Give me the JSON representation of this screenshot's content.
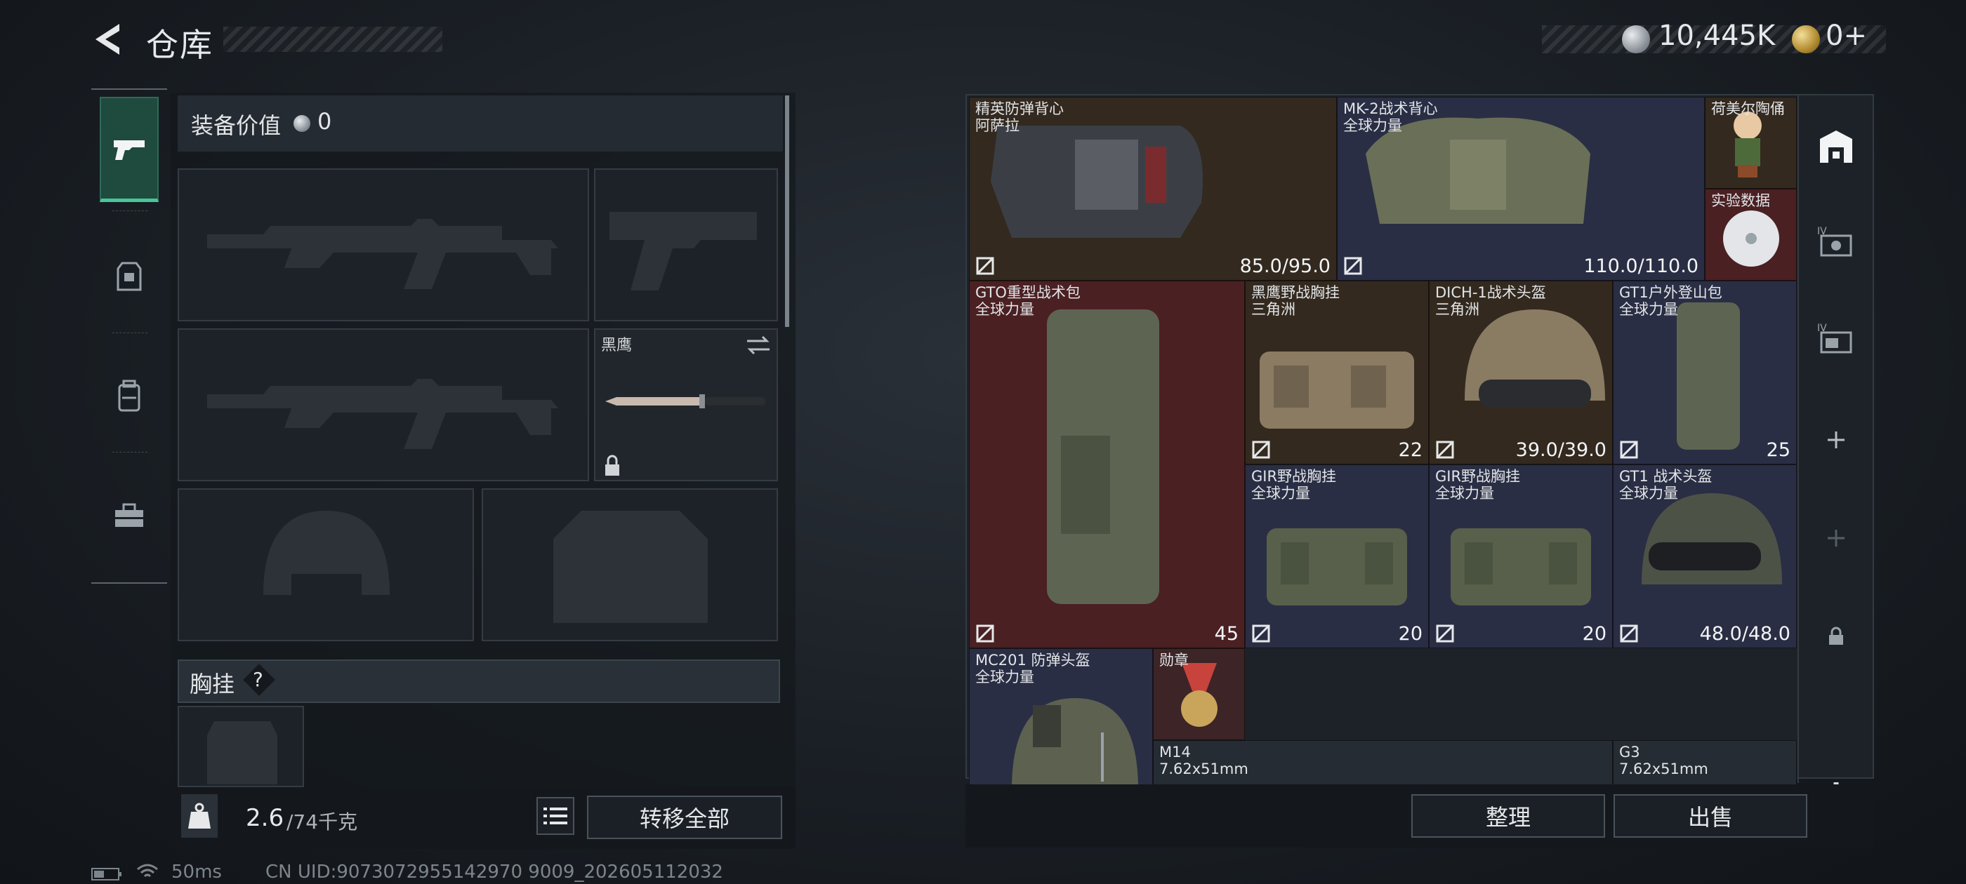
{
  "header": {
    "title": "仓库"
  },
  "currency": {
    "silver_value": "10,445K",
    "gold_value": "0+"
  },
  "equipment": {
    "value_label": "装备价值",
    "value_amount": "0",
    "knife_slot_label": "黑鹰",
    "section_title": "胸挂",
    "section_help": "?"
  },
  "weight": {
    "current": "2.6",
    "max_unit": "/74千克"
  },
  "buttons": {
    "transfer_all": "转移全部",
    "organize": "整理",
    "sell": "出售"
  },
  "status_bar": {
    "ping": "50ms",
    "uid": "CN UID:9073072955142970 9009_202605112032"
  },
  "inventory": {
    "items": [
      {
        "name": "精英防弹背心",
        "source": "阿萨拉",
        "value": "85.0/95.0",
        "bg": "brown"
      },
      {
        "name": "MK-2战术背心",
        "source": "全球力量",
        "value": "110.0/110.0",
        "bg": "navy"
      },
      {
        "name": "荷美尔陶俑",
        "source": "",
        "value": "",
        "bg": "brown"
      },
      {
        "name": "实验数据",
        "source": "",
        "value": "",
        "bg": "red"
      },
      {
        "name": "GTO重型战术包",
        "source": "全球力量",
        "value": "45",
        "bg": "red"
      },
      {
        "name": "黑鹰野战胸挂",
        "source": "三角洲",
        "value": "22",
        "bg": "brown"
      },
      {
        "name": "DICH-1战术头盔",
        "source": "三角洲",
        "value": "39.0/39.0",
        "bg": "brown"
      },
      {
        "name": "GT1户外登山包",
        "source": "全球力量",
        "value": "25",
        "bg": "navy"
      },
      {
        "name": "GIR野战胸挂",
        "source": "全球力量",
        "value": "20",
        "bg": "navy"
      },
      {
        "name": "GIR野战胸挂",
        "source": "全球力量",
        "value": "20",
        "bg": "navy"
      },
      {
        "name": "GT1 战术头盔",
        "source": "全球力量",
        "value": "48.0/48.0",
        "bg": "navy"
      },
      {
        "name": "MC201 防弹头盔",
        "source": "全球力量",
        "value": "",
        "bg": "navy"
      },
      {
        "name": "勋章",
        "source": "",
        "value": "",
        "bg": "wine"
      },
      {
        "name": "M14",
        "source": "7.62x51mm",
        "value": "",
        "bg": "gray"
      },
      {
        "name": "G3",
        "source": "7.62x51mm",
        "value": "",
        "bg": "gray"
      }
    ]
  },
  "colors": {
    "accent_green": "#47c79a",
    "tab_active_bg": "#1f4a3e"
  }
}
